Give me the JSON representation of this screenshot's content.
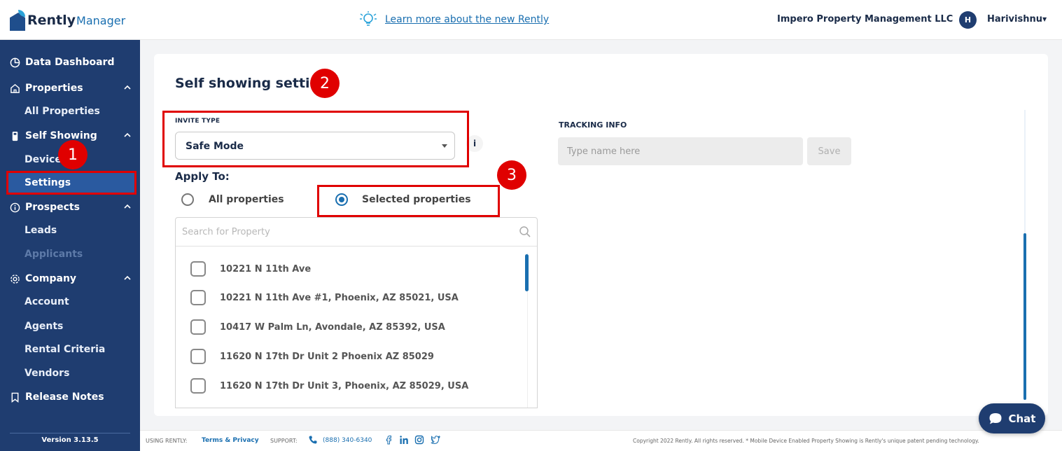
{
  "header": {
    "logo_primary": "Rently",
    "logo_secondary": "Manager",
    "learn_link": "Learn more about the new Rently",
    "company": "Impero Property Management LLC",
    "avatar_initial": "H",
    "user_name": "Harivishnu"
  },
  "sidebar": {
    "data_dashboard": "Data Dashboard",
    "properties": "Properties",
    "all_properties": "All Properties",
    "self_showing": "Self Showing",
    "devices": "Devices",
    "settings": "Settings",
    "prospects": "Prospects",
    "leads": "Leads",
    "applicants": "Applicants",
    "company": "Company",
    "account": "Account",
    "agents": "Agents",
    "rental_criteria": "Rental Criteria",
    "vendors": "Vendors",
    "release_notes": "Release Notes",
    "version": "Version 3.13.5"
  },
  "main": {
    "title": "Self showing setting",
    "invite_type_label": "INVITE TYPE",
    "invite_type_value": "Safe Mode",
    "info_glyph": "i",
    "apply_to_label": "Apply To:",
    "radio_all": "All properties",
    "radio_selected": "Selected properties",
    "search_placeholder": "Search for Property",
    "properties": [
      "10221 N 11th Ave",
      "10221 N 11th Ave #1, Phoenix, AZ 85021, USA",
      "10417 W Palm Ln, Avondale, AZ 85392, USA",
      "11620 N 17th Dr Unit 2 Phoenix AZ 85029",
      "11620 N 17th Dr Unit 3, Phoenix, AZ 85029, USA"
    ],
    "tracking_label": "TRACKING INFO",
    "tracking_placeholder": "Type name here",
    "save_label": "Save"
  },
  "annotations": [
    "1",
    "2",
    "3"
  ],
  "footer": {
    "using_label": "USING RENTLY:",
    "terms": "Terms & Privacy",
    "support_label": "SUPPORT:",
    "phone": "(888) 340-6340",
    "copyright": "Copyright 2022 Rently. All rights reserved. * Mobile Device Enabled Property Showing is Rently's unique patent pending technology."
  },
  "chat_label": "Chat",
  "colors": {
    "sidebar_bg": "#1f3d70",
    "accent": "#1a6fb0",
    "annotation_red": "#e00000"
  }
}
